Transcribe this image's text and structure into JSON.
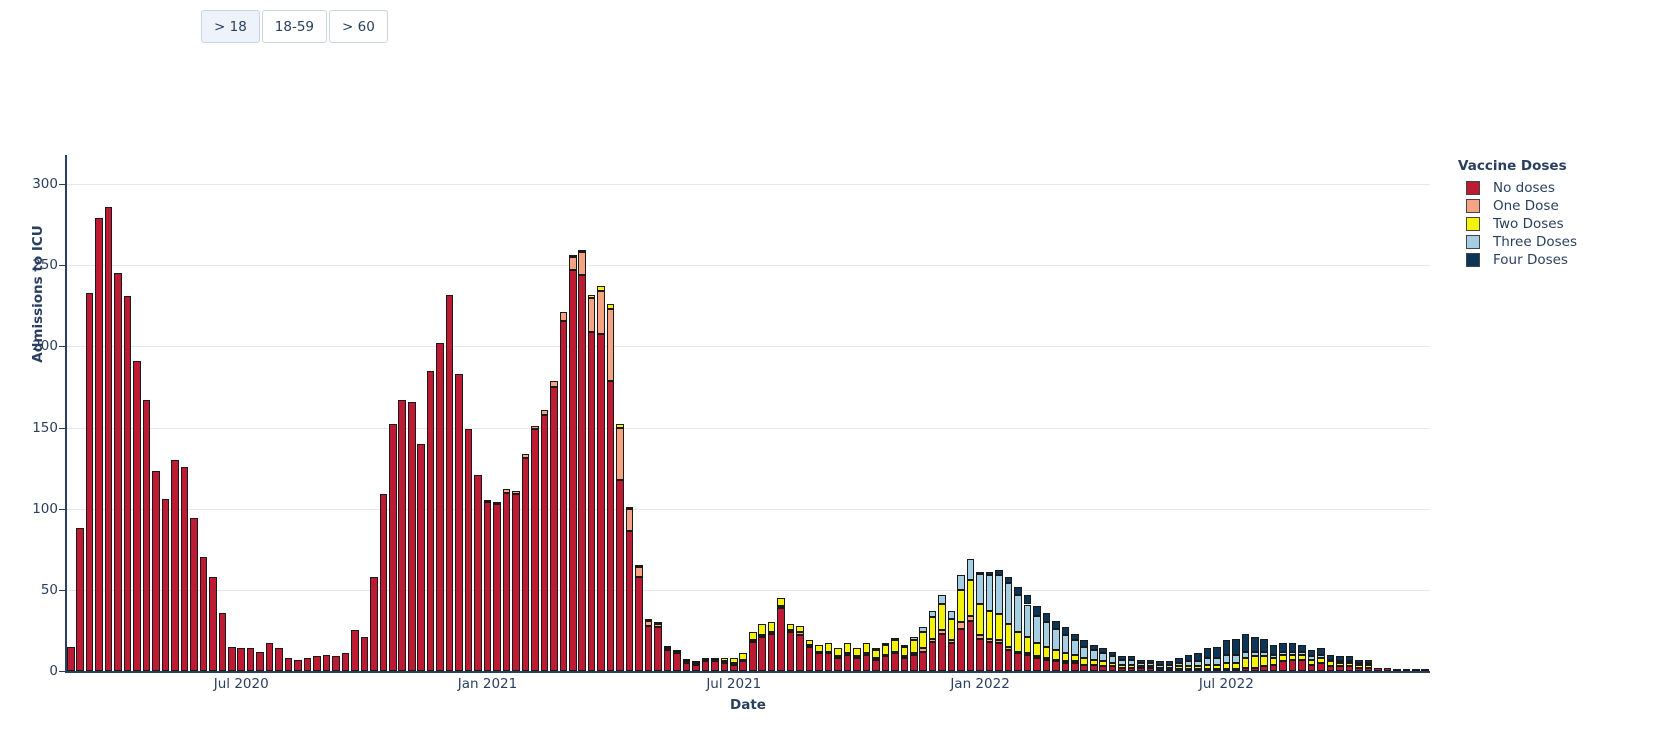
{
  "toolbar": {
    "age_buttons": [
      {
        "label": "> 18",
        "active": true
      },
      {
        "label": "18-59",
        "active": false
      },
      {
        "label": "> 60",
        "active": false
      }
    ]
  },
  "legend": {
    "title": "Vaccine Doses",
    "items": [
      {
        "label": "No doses",
        "color": "#bd1b34"
      },
      {
        "label": "One Dose",
        "color": "#f5a383"
      },
      {
        "label": "Two Doses",
        "color": "#f2f20d"
      },
      {
        "label": "Three Doses",
        "color": "#a6cee3"
      },
      {
        "label": "Four Doses",
        "color": "#0d3557"
      }
    ]
  },
  "chart_data": {
    "type": "bar",
    "stacked": true,
    "title": "",
    "xlabel": "Date",
    "ylabel": "Admissions to ICU",
    "ylim": [
      0,
      310
    ],
    "yticks": [
      0,
      50,
      100,
      150,
      200,
      250,
      300
    ],
    "grid": true,
    "legend_position": "right",
    "xticks": [
      {
        "label": "Jul 2020",
        "index": 18
      },
      {
        "label": "Jan 2021",
        "index": 44
      },
      {
        "label": "Jul 2021",
        "index": 70
      },
      {
        "label": "Jan 2022",
        "index": 96
      },
      {
        "label": "Jul 2022",
        "index": 122
      }
    ],
    "x_unit": "week",
    "n_points": 144,
    "series": [
      {
        "name": "No doses",
        "color": "#bd1b34",
        "values": [
          15,
          88,
          233,
          279,
          286,
          245,
          231,
          191,
          167,
          123,
          106,
          130,
          126,
          94,
          70,
          58,
          36,
          15,
          14,
          14,
          12,
          17,
          14,
          8,
          7,
          8,
          9,
          10,
          9,
          11,
          25,
          21,
          58,
          109,
          152,
          167,
          166,
          140,
          185,
          202,
          232,
          183,
          149,
          121,
          104,
          103,
          110,
          109,
          131,
          149,
          158,
          175,
          216,
          247,
          244,
          209,
          208,
          179,
          118,
          86,
          58,
          28,
          27,
          13,
          11,
          5,
          4,
          6,
          6,
          5,
          4,
          6,
          18,
          21,
          23,
          39,
          24,
          22,
          15,
          11,
          11,
          8,
          10,
          8,
          10,
          7,
          9,
          11,
          8,
          10,
          12,
          18,
          23,
          17,
          26,
          31,
          20,
          18,
          17,
          13,
          11,
          10,
          8,
          7,
          6,
          5,
          5,
          4,
          4,
          3,
          3,
          2,
          2,
          2,
          2,
          1,
          1,
          1,
          1,
          1,
          1,
          1,
          1,
          1,
          2,
          2,
          3,
          4,
          6,
          7,
          7,
          4,
          5,
          3,
          3,
          3,
          2,
          2,
          2,
          2,
          1,
          1,
          1,
          1
        ]
      },
      {
        "name": "One Dose",
        "color": "#f5a383",
        "values": [
          0,
          0,
          0,
          0,
          0,
          0,
          0,
          0,
          0,
          0,
          0,
          0,
          0,
          0,
          0,
          0,
          0,
          0,
          0,
          0,
          0,
          0,
          0,
          0,
          0,
          0,
          0,
          0,
          0,
          0,
          0,
          0,
          0,
          0,
          0,
          0,
          0,
          0,
          0,
          0,
          0,
          0,
          0,
          0,
          1,
          1,
          2,
          2,
          3,
          2,
          3,
          4,
          5,
          8,
          14,
          21,
          26,
          44,
          32,
          14,
          6,
          3,
          2,
          1,
          1,
          1,
          1,
          1,
          1,
          1,
          1,
          1,
          1,
          1,
          1,
          1,
          1,
          2,
          1,
          1,
          1,
          1,
          1,
          1,
          1,
          1,
          1,
          1,
          1,
          1,
          2,
          2,
          2,
          2,
          4,
          3,
          2,
          2,
          2,
          2,
          1,
          1,
          1,
          1,
          1,
          1,
          1,
          0,
          0,
          0,
          0,
          0,
          0,
          0,
          0,
          0,
          0,
          0,
          0,
          0,
          0,
          0,
          0,
          0,
          0,
          0,
          0,
          0,
          0,
          0,
          0,
          0,
          0,
          0,
          0,
          0,
          0,
          0,
          0,
          0
        ]
      },
      {
        "name": "Two Doses",
        "color": "#f2f20d",
        "values": [
          0,
          0,
          0,
          0,
          0,
          0,
          0,
          0,
          0,
          0,
          0,
          0,
          0,
          0,
          0,
          0,
          0,
          0,
          0,
          0,
          0,
          0,
          0,
          0,
          0,
          0,
          0,
          0,
          0,
          0,
          0,
          0,
          0,
          0,
          0,
          0,
          0,
          0,
          0,
          0,
          0,
          0,
          0,
          0,
          0,
          0,
          0,
          0,
          0,
          0,
          0,
          0,
          0,
          1,
          1,
          2,
          3,
          3,
          2,
          1,
          1,
          1,
          1,
          1,
          1,
          1,
          1,
          1,
          1,
          2,
          3,
          4,
          5,
          7,
          6,
          5,
          4,
          4,
          3,
          4,
          5,
          5,
          6,
          5,
          6,
          5,
          6,
          7,
          6,
          8,
          10,
          13,
          16,
          13,
          20,
          22,
          19,
          17,
          16,
          14,
          12,
          10,
          8,
          7,
          6,
          5,
          4,
          4,
          3,
          3,
          2,
          2,
          2,
          1,
          1,
          1,
          1,
          2,
          2,
          2,
          3,
          3,
          4,
          4,
          6,
          7,
          6,
          4,
          4,
          3,
          3,
          3,
          3,
          3,
          2,
          2,
          2,
          2
        ]
      },
      {
        "name": "Three Doses",
        "color": "#a6cee3",
        "values": [
          0,
          0,
          0,
          0,
          0,
          0,
          0,
          0,
          0,
          0,
          0,
          0,
          0,
          0,
          0,
          0,
          0,
          0,
          0,
          0,
          0,
          0,
          0,
          0,
          0,
          0,
          0,
          0,
          0,
          0,
          0,
          0,
          0,
          0,
          0,
          0,
          0,
          0,
          0,
          0,
          0,
          0,
          0,
          0,
          0,
          0,
          0,
          0,
          0,
          0,
          0,
          0,
          0,
          0,
          0,
          0,
          0,
          0,
          0,
          0,
          0,
          0,
          0,
          0,
          0,
          0,
          0,
          0,
          0,
          0,
          0,
          0,
          0,
          0,
          0,
          0,
          0,
          0,
          0,
          0,
          0,
          0,
          0,
          0,
          0,
          1,
          1,
          1,
          1,
          2,
          3,
          4,
          6,
          5,
          9,
          13,
          19,
          22,
          24,
          25,
          23,
          20,
          17,
          15,
          13,
          11,
          9,
          7,
          6,
          5,
          4,
          3,
          3,
          2,
          2,
          2,
          2,
          2,
          3,
          3,
          4,
          4,
          5,
          5,
          4,
          3,
          3,
          2,
          2,
          2,
          2,
          2,
          2,
          1,
          1,
          1,
          1,
          1
        ]
      },
      {
        "name": "Four Doses",
        "color": "#0d3557",
        "values": [
          0,
          0,
          0,
          0,
          0,
          0,
          0,
          0,
          0,
          0,
          0,
          0,
          0,
          0,
          0,
          0,
          0,
          0,
          0,
          0,
          0,
          0,
          0,
          0,
          0,
          0,
          0,
          0,
          0,
          0,
          0,
          0,
          0,
          0,
          0,
          0,
          0,
          0,
          0,
          0,
          0,
          0,
          0,
          0,
          0,
          0,
          0,
          0,
          0,
          0,
          0,
          0,
          0,
          0,
          0,
          0,
          0,
          0,
          0,
          0,
          0,
          0,
          0,
          0,
          0,
          0,
          0,
          0,
          0,
          0,
          0,
          0,
          0,
          0,
          0,
          0,
          0,
          0,
          0,
          0,
          0,
          0,
          0,
          0,
          0,
          0,
          0,
          0,
          0,
          0,
          0,
          0,
          0,
          0,
          0,
          0,
          1,
          2,
          3,
          4,
          5,
          6,
          6,
          6,
          5,
          5,
          4,
          4,
          3,
          3,
          3,
          2,
          2,
          2,
          2,
          2,
          2,
          3,
          4,
          5,
          6,
          7,
          9,
          10,
          11,
          9,
          8,
          6,
          5,
          5,
          4,
          4,
          4,
          3,
          3,
          3,
          2,
          2
        ]
      }
    ]
  }
}
